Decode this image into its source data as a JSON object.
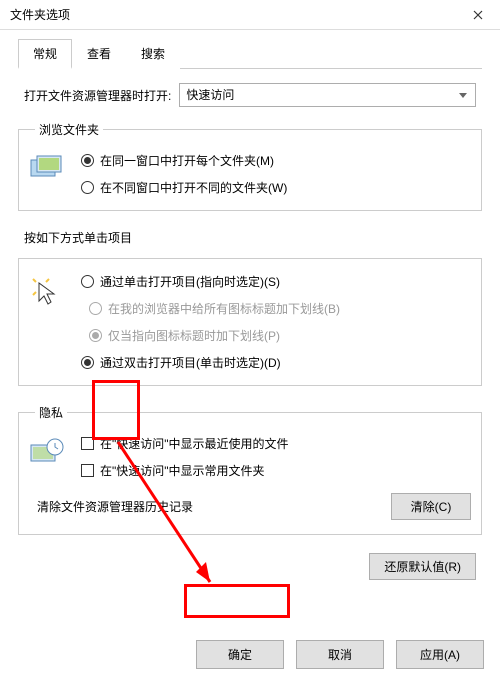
{
  "window": {
    "title": "文件夹选项"
  },
  "tabs": {
    "t0": "常规",
    "t1": "查看",
    "t2": "搜索"
  },
  "open": {
    "label": "打开文件资源管理器时打开:",
    "value": "快速访问"
  },
  "browse": {
    "legend": "浏览文件夹",
    "r0": "在同一窗口中打开每个文件夹(M)",
    "r1": "在不同窗口中打开不同的文件夹(W)"
  },
  "click": {
    "legend": "按如下方式单击项目",
    "r0": "通过单击打开项目(指向时选定)(S)",
    "r0a": "在我的浏览器中给所有图标标题加下划线(B)",
    "r0b": "仅当指向图标标题时加下划线(P)",
    "r1": "通过双击打开项目(单击时选定)(D)"
  },
  "privacy": {
    "legend": "隐私",
    "c0": "在\"快速访问\"中显示最近使用的文件",
    "c1": "在\"快速访问\"中显示常用文件夹",
    "historyLabel": "清除文件资源管理器历史记录",
    "clearBtn": "清除(C)"
  },
  "restoreBtn": "还原默认值(R)",
  "buttons": {
    "ok": "确定",
    "cancel": "取消",
    "apply": "应用(A)"
  }
}
